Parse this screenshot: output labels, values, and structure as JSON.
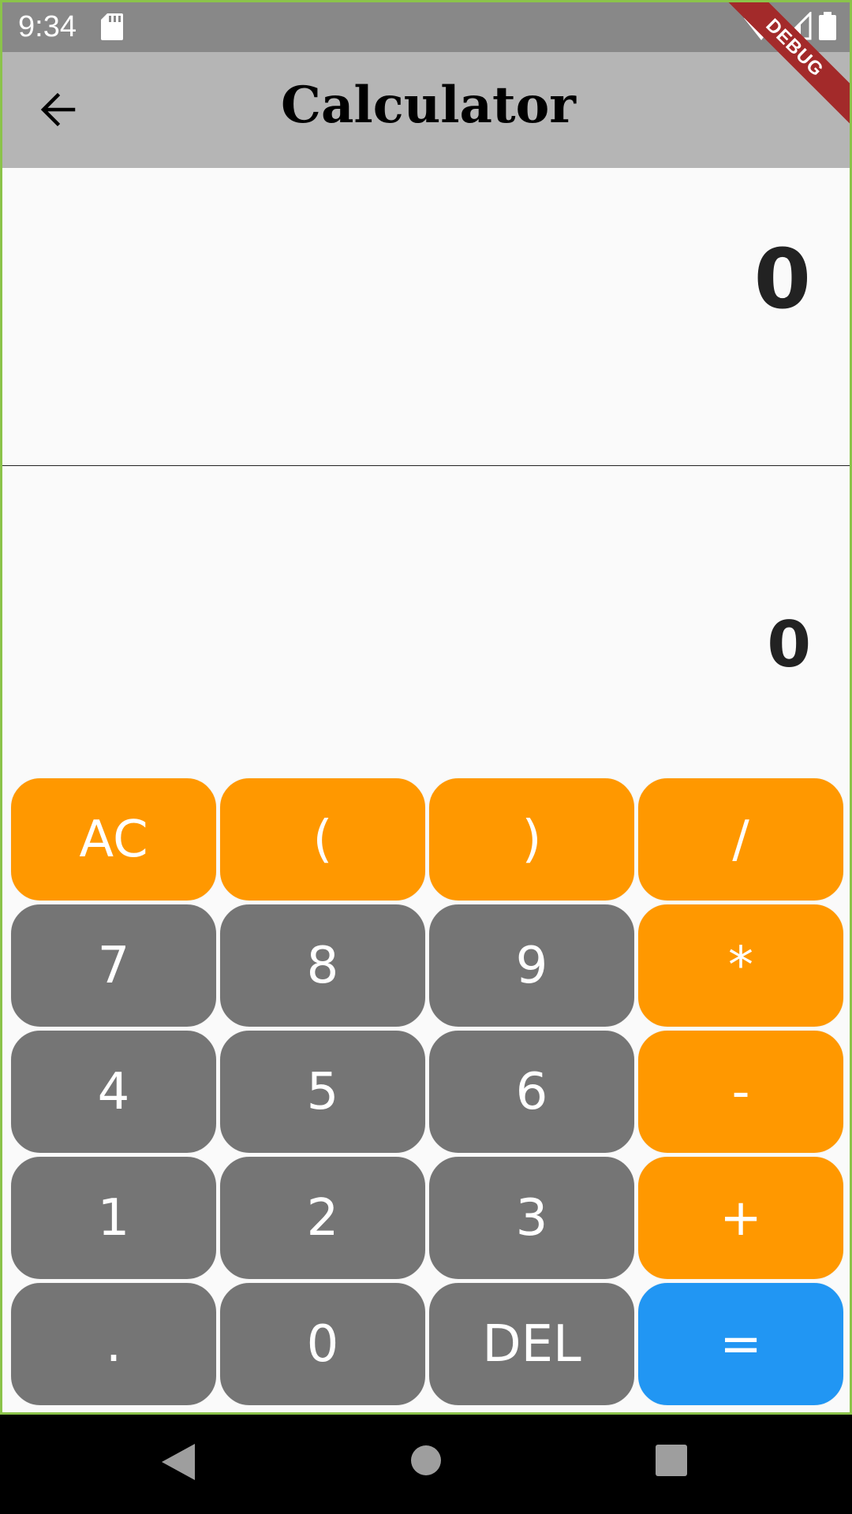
{
  "status": {
    "time": "9:34"
  },
  "appbar": {
    "title": "Calculator",
    "banner": "DEBUG"
  },
  "display": {
    "equation": "0",
    "result": "0"
  },
  "keys": [
    {
      "label": "AC",
      "color": "orange"
    },
    {
      "label": "(",
      "color": "orange"
    },
    {
      "label": ")",
      "color": "orange"
    },
    {
      "label": "/",
      "color": "orange"
    },
    {
      "label": "7",
      "color": "gray"
    },
    {
      "label": "8",
      "color": "gray"
    },
    {
      "label": "9",
      "color": "gray"
    },
    {
      "label": "*",
      "color": "orange"
    },
    {
      "label": "4",
      "color": "gray"
    },
    {
      "label": "5",
      "color": "gray"
    },
    {
      "label": "6",
      "color": "gray"
    },
    {
      "label": "-",
      "color": "orange"
    },
    {
      "label": "1",
      "color": "gray"
    },
    {
      "label": "2",
      "color": "gray"
    },
    {
      "label": "3",
      "color": "gray"
    },
    {
      "label": "+",
      "color": "orange"
    },
    {
      "label": ".",
      "color": "gray"
    },
    {
      "label": "0",
      "color": "gray"
    },
    {
      "label": "DEL",
      "color": "gray"
    },
    {
      "label": "=",
      "color": "blue"
    }
  ],
  "colors": {
    "orange": "#ff9800",
    "gray": "#757575",
    "blue": "#2196f3",
    "appbar": "#b5b5b5",
    "statusbar": "#888888"
  },
  "icons": {
    "back": "arrow-left-icon",
    "sd": "sd-card-icon",
    "wifi": "wifi-icon",
    "signal": "signal-icon",
    "battery": "battery-icon",
    "nav_back": "triangle-back-icon",
    "nav_home": "circle-home-icon",
    "nav_recent": "square-recent-icon"
  }
}
